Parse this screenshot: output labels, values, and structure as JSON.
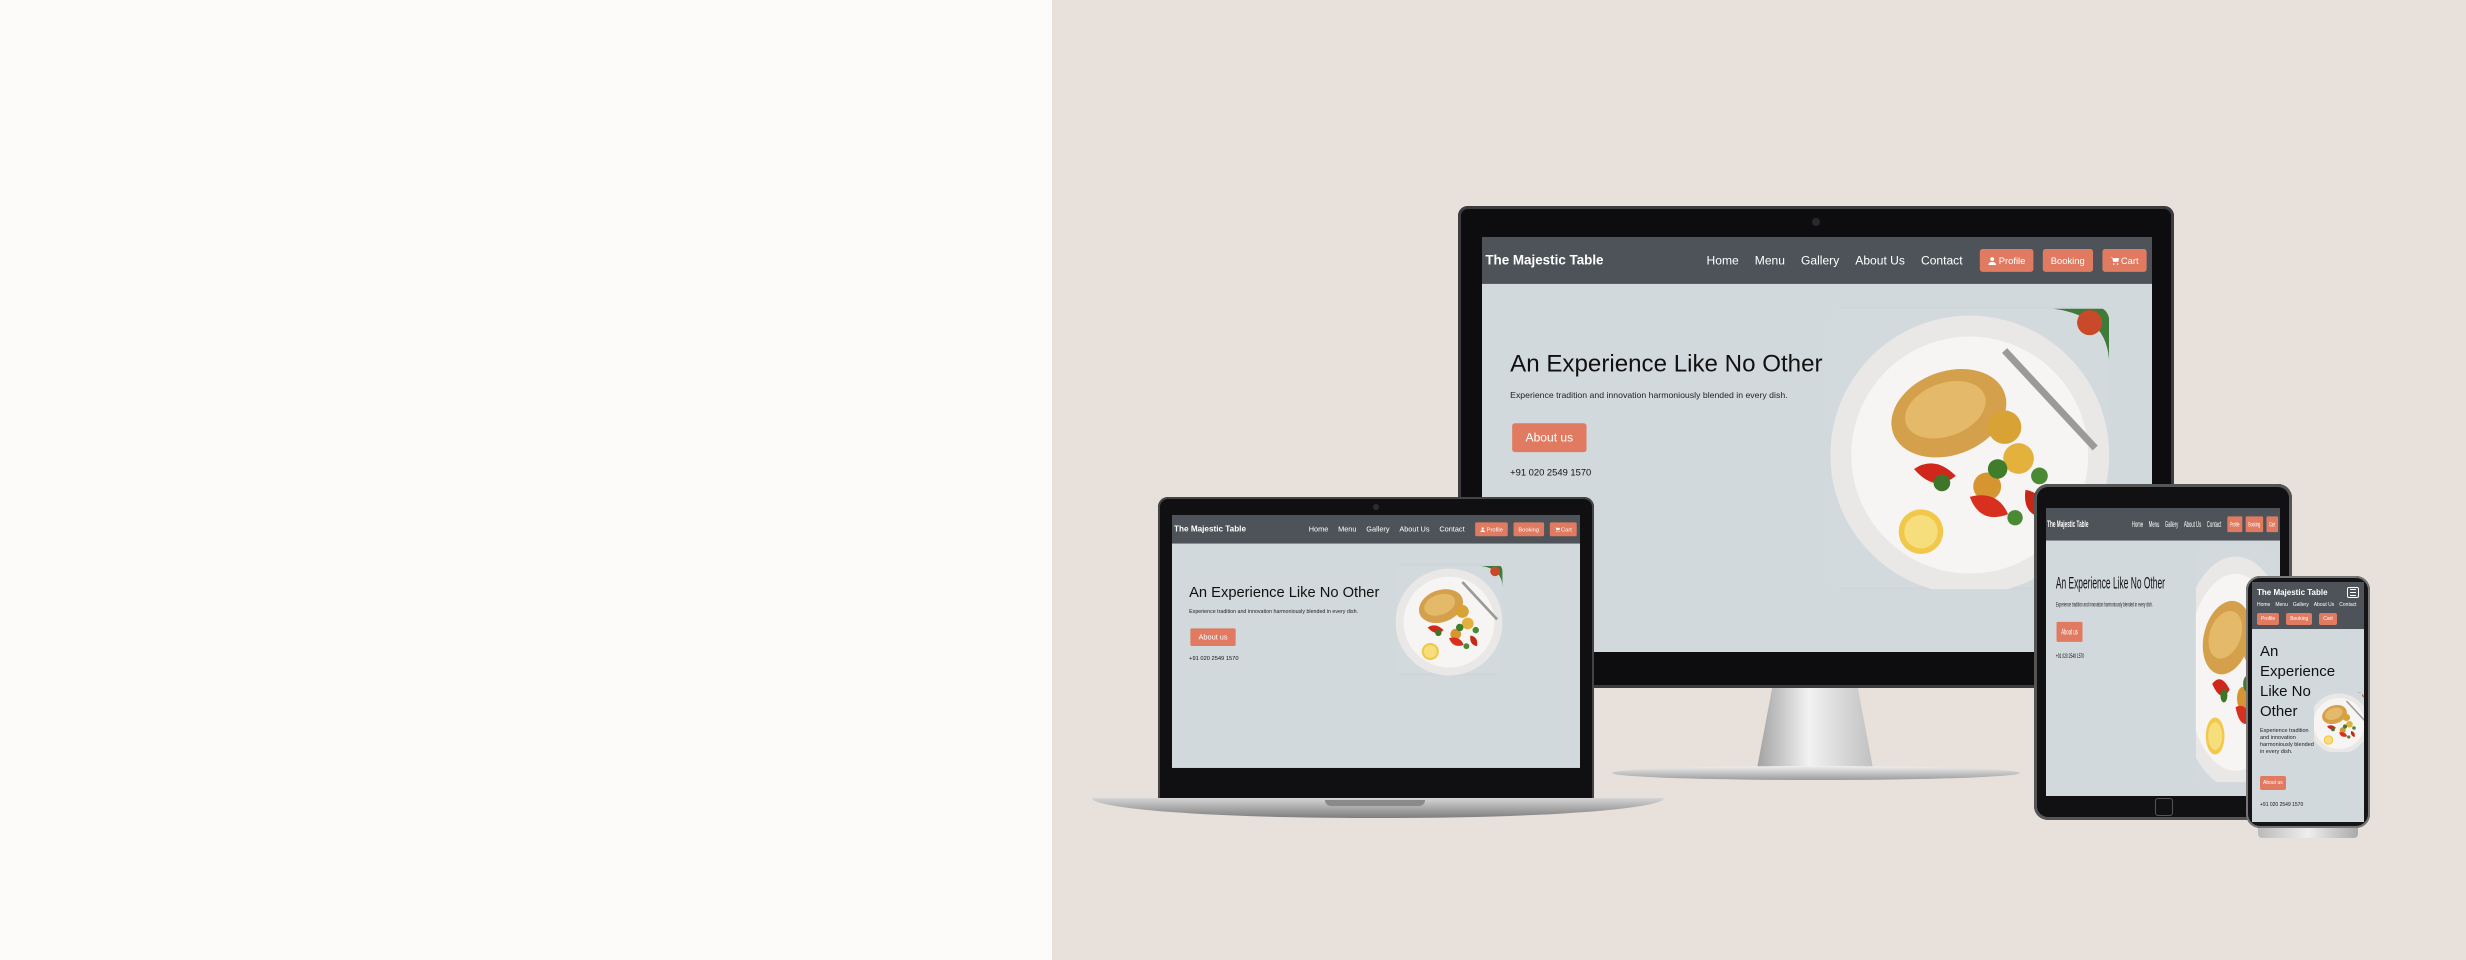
{
  "site": {
    "brand": "The Majestic Table",
    "nav": [
      "Home",
      "Menu",
      "Gallery",
      "About Us",
      "Contact"
    ],
    "buttons": {
      "profile": "Profile",
      "booking": "Booking",
      "cart": "Cart"
    },
    "hero": {
      "title": "An Experience Like No Other",
      "subtitle": "Experience tradition and innovation harmoniously blended in every dish.",
      "cta": "About us",
      "phone": "+91 020 2549 1570"
    }
  },
  "mobile": {
    "buttons": {
      "profile": "Profile",
      "booking": "Booking",
      "cart": "Cart"
    },
    "cta": "About us"
  },
  "colors": {
    "left_background": "#fcfbfa",
    "right_background": "#e8e1db",
    "nav_bar": "#4d5358",
    "accent_button": "#e07b62",
    "page_background": "#d2d9dc"
  },
  "icons": [
    "user-icon",
    "cart-icon",
    "hamburger-icon",
    "food-plate-image"
  ]
}
